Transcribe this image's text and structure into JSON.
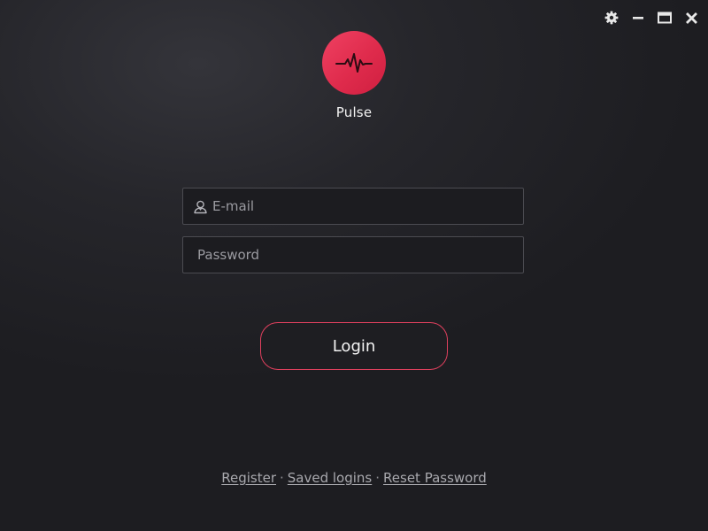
{
  "window_controls": {
    "settings_icon": "gear-icon",
    "minimize_icon": "minimize-icon",
    "maximize_icon": "maximize-icon",
    "close_icon": "close-icon"
  },
  "brand": {
    "name": "Pulse",
    "logo_icon": "pulse-wave-icon",
    "logo_color": "#e2304f"
  },
  "form": {
    "email_placeholder": "E-mail",
    "email_value": "",
    "email_icon": "user-icon",
    "password_placeholder": "Password",
    "password_value": "",
    "login_label": "Login"
  },
  "footer": {
    "links": [
      {
        "label": "Register"
      },
      {
        "label": "Saved logins"
      },
      {
        "label": "Reset Password"
      }
    ],
    "separator": "·"
  },
  "colors": {
    "accent": "#e2304f",
    "background": "#232327",
    "field_border": "#4b4b51"
  }
}
